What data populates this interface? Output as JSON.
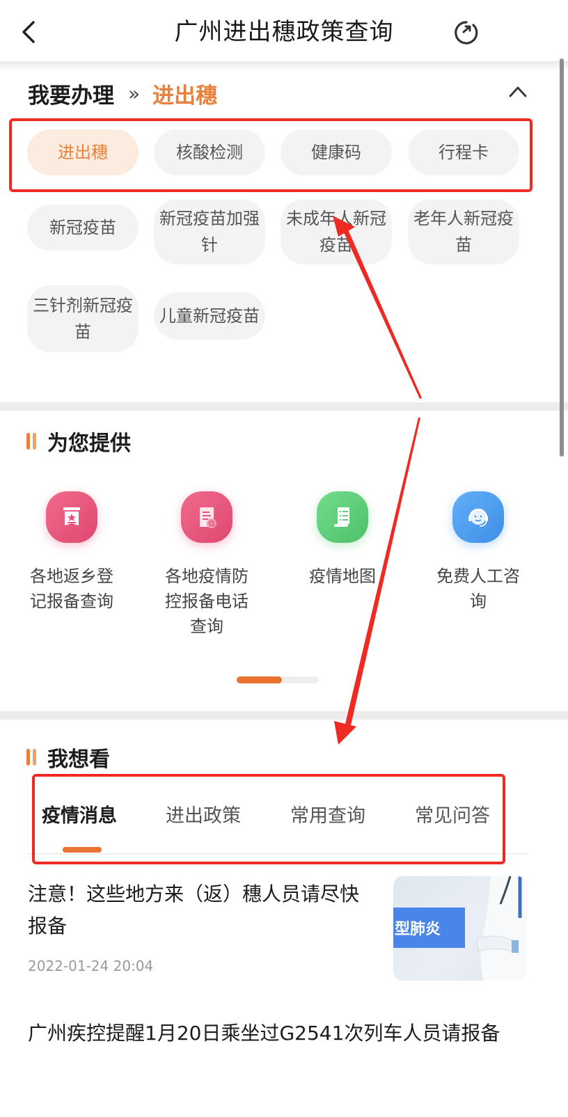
{
  "header": {
    "title": "广州进出穗政策查询",
    "back_icon": "chevron-left-icon",
    "refresh_icon": "refresh-icon"
  },
  "handle": {
    "label": "我要办理",
    "separator": "»",
    "current": "进出穗",
    "collapse_icon": "chevron-up-icon",
    "chips": [
      {
        "label": "进出穗",
        "active": true
      },
      {
        "label": "核酸检测",
        "active": false
      },
      {
        "label": "健康码",
        "active": false
      },
      {
        "label": "行程卡",
        "active": false
      },
      {
        "label": "新冠疫苗",
        "active": false
      },
      {
        "label": "新冠疫苗加强针",
        "active": false
      },
      {
        "label": "未成年人新冠疫苗",
        "active": false
      },
      {
        "label": "老年人新冠疫苗",
        "active": false
      },
      {
        "label": "三针剂新冠疫苗",
        "active": false
      },
      {
        "label": "儿童新冠疫苗",
        "active": false
      }
    ]
  },
  "provide": {
    "title": "为您提供",
    "services": [
      {
        "label": "各地返乡登记报备查询",
        "icon": "registration-icon",
        "color": "#e8557a"
      },
      {
        "label": "各地疫情防控报备电话查询",
        "icon": "document-search-icon",
        "color": "#e8557a"
      },
      {
        "label": "疫情地图",
        "icon": "scroll-list-icon",
        "color": "#5fcc78"
      },
      {
        "label": "免费人工咨询",
        "icon": "headset-agent-icon",
        "color": "#4d9ef0"
      }
    ],
    "pager_progress": 0.55
  },
  "want": {
    "title": "我想看",
    "tabs": [
      {
        "label": "疫情消息",
        "active": true
      },
      {
        "label": "进出政策",
        "active": false
      },
      {
        "label": "常用查询",
        "active": false
      },
      {
        "label": "常见问答",
        "active": false
      }
    ],
    "news": [
      {
        "title": "注意！这些地方来（返）穗人员请尽快报备",
        "time": "2022-01-24 20:04",
        "thumb_text": "型肺炎"
      },
      {
        "title": "广州疾控提醒1月20日乘坐过G2541次列车人员请报备"
      }
    ]
  },
  "colors": {
    "accent": "#e8803a",
    "annotation_red": "#ee2a22"
  }
}
